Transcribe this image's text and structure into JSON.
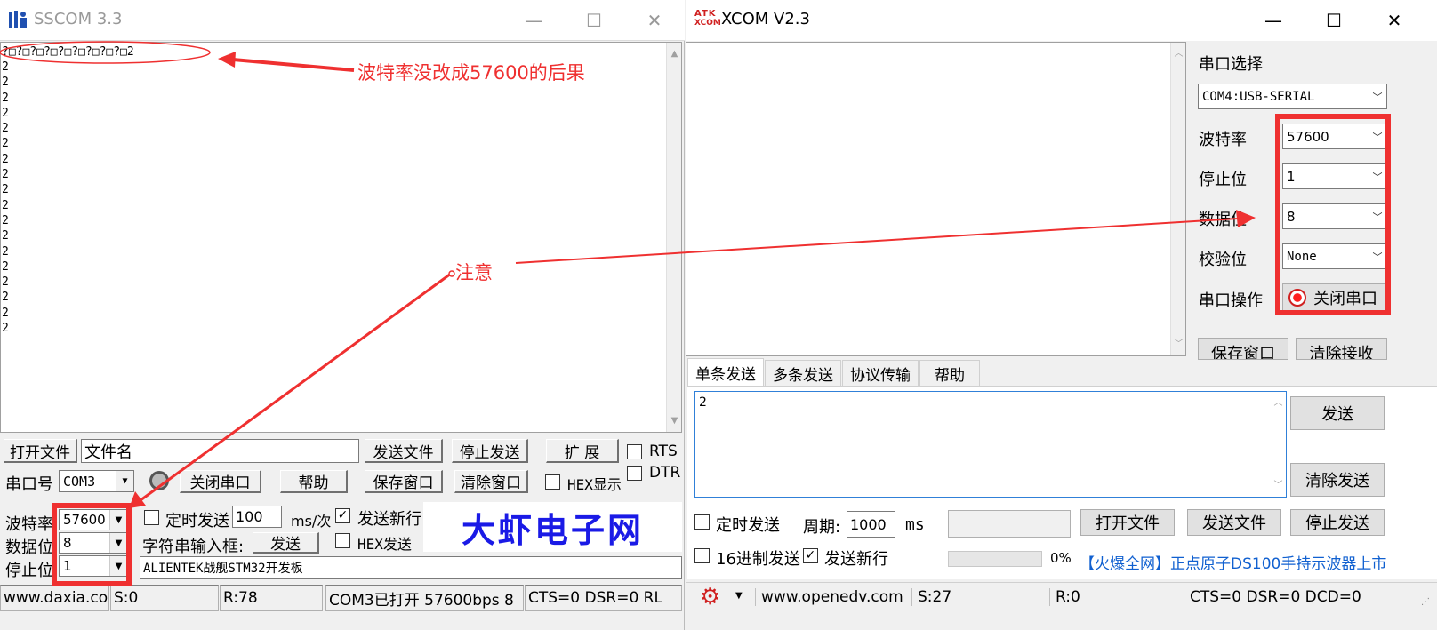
{
  "sscom": {
    "title": "SSCOM 3.3",
    "first_line": "?□?□?□?□?□?□?□?□?□2",
    "receive_lines": [
      "2",
      "2",
      "2",
      "2",
      "2",
      "2",
      "2",
      "2",
      "2",
      "2",
      "2",
      "2",
      "2",
      "2",
      "2",
      "2",
      "2",
      "2"
    ],
    "open_file_btn": "打开文件",
    "filename_value": "文件名",
    "send_file_btn": "发送文件",
    "stop_send_btn": "停止发送",
    "expand_btn": "扩 展",
    "rts_label": "RTS",
    "dtr_label": "DTR",
    "port_label": "串口号",
    "port_value": "COM3",
    "close_port_btn": "关闭串口",
    "help_btn": "帮助",
    "save_window_btn": "保存窗口",
    "clear_window_btn": "清除窗口",
    "hex_display_label": "HEX显示",
    "baud_label": "波特率",
    "baud_value": "57600",
    "databits_label": "数据位",
    "databits_value": "8",
    "stopbits_label": "停止位",
    "stopbits_value": "1",
    "timed_send_label": "定时发送",
    "interval_value": "100",
    "interval_unit": "ms/次",
    "send_newline_label": "发送新行",
    "string_input_label": "字符串输入框:",
    "send_btn": "发送",
    "hex_send_label": "HEX发送",
    "input_value": "ALIENTEK战舰STM32开发板",
    "logo_text": "大虾电子网",
    "status_site": "www.daxia.com",
    "status_s": "S:0",
    "status_r": "R:78",
    "status_port": "COM3已打开  57600bps  8",
    "status_lines": "CTS=0 DSR=0 RL"
  },
  "xcom": {
    "logo_line1": "ATK",
    "logo_line2": "XCOM",
    "title": "XCOM V2.3",
    "port_select_label": "串口选择",
    "port_select_value": "COM4:USB-SERIAL",
    "baud_label": "波特率",
    "baud_value": "57600",
    "stopbits_label": "停止位",
    "stopbits_value": "1",
    "databits_label": "数据位",
    "databits_value": "8",
    "parity_label": "校验位",
    "parity_value": "None",
    "port_op_label": "串口操作",
    "close_port_btn": "关闭串口",
    "save_window_btn": "保存窗口",
    "clear_receive_btn": "清除接收",
    "tabs": [
      "单条发送",
      "多条发送",
      "协议传输",
      "帮助"
    ],
    "send_text": "2",
    "send_btn": "发送",
    "clear_send_btn": "清除发送",
    "timed_send_label": "定时发送",
    "period_label": "周期:",
    "period_value": "1000",
    "period_unit": "ms",
    "open_file_btn": "打开文件",
    "send_file_btn": "发送文件",
    "stop_send_btn": "停止发送",
    "hex_send_label": "16进制发送",
    "send_newline_label": "发送新行",
    "progress_text": "0%",
    "ad_bracket": "【火爆全网】",
    "ad_text": "正点原子DS100手持示波器上市",
    "status_site": "www.openedv.com",
    "status_s": "S:27",
    "status_r": "R:0",
    "status_lines": "CTS=0 DSR=0 DCD=0"
  },
  "annotations": {
    "consequence": "波特率没改成57600的后果",
    "note": "注意"
  },
  "colors": {
    "annotation_red": "#ef3030",
    "logo_blue": "#1a1ae6",
    "ad_blue": "#1060d0"
  }
}
